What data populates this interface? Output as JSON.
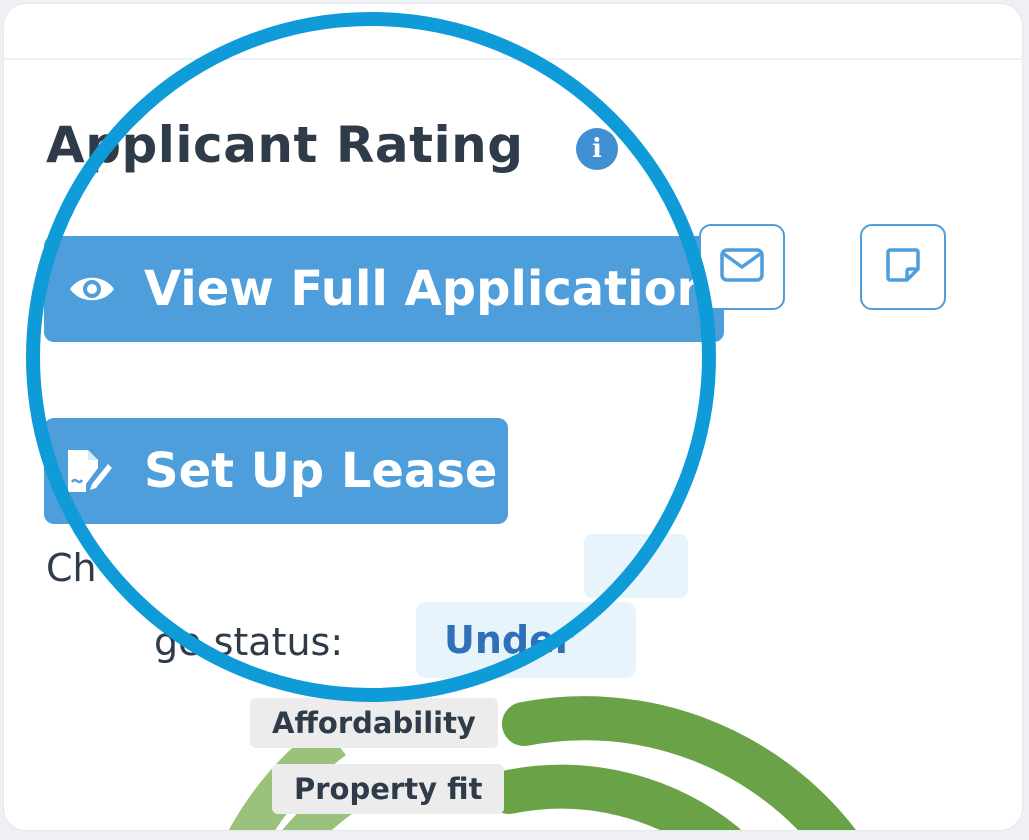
{
  "panel": {
    "title": "Applicant Rating",
    "info_icon": "info-icon"
  },
  "actions": {
    "view_full_application": "View Full Application",
    "set_up_lease": "Set Up Lease",
    "email_icon": "envelope-icon",
    "note_icon": "sticky-note-icon"
  },
  "details": {
    "partial_label": "Ch",
    "stage_label": "ge status:",
    "stage_value": "Under"
  },
  "rating_bars": {
    "labels": [
      "Affordability",
      "Property fit",
      ""
    ],
    "colors": {
      "outer": "#6aa247",
      "inner": "#9ac27c"
    }
  },
  "colors": {
    "accent": "#4d9edb",
    "magnifier": "#0f9ad8",
    "badge_bg": "#e8f4fc",
    "text": "#2f3b48"
  }
}
